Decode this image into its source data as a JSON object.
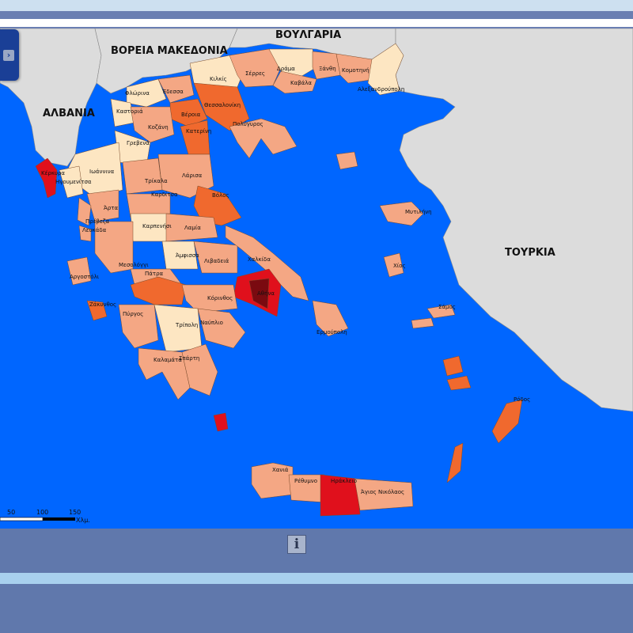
{
  "map": {
    "colors": {
      "sea": "#0066ff",
      "neighbor_land": "#dcdcdc",
      "tier1": "#fde6c2",
      "tier2": "#f4a784",
      "tier3": "#f0692e",
      "tier4": "#e0101c",
      "tier5": "#7a0a10"
    },
    "countries": [
      {
        "id": "albania",
        "label": "ΑΛΒΑΝΙΑ"
      },
      {
        "id": "north-macedonia",
        "label": "ΒΟΡΕΙΑ ΜΑΚΕΔΟΝΙΑ"
      },
      {
        "id": "bulgaria",
        "label": "ΒΟΥΛΓΑΡΙΑ"
      },
      {
        "id": "turkey",
        "label": "ΤΟΥΡΚΙΑ"
      }
    ],
    "cities": [
      "Κιλκίς",
      "Σέρρες",
      "Δράμα",
      "Ξάνθη",
      "Κομοτηνή",
      "Καβάλα",
      "Αλεξανδρούπολη",
      "Φλώρινα",
      "Έδεσσα",
      "Καστοριά",
      "Θεσσαλονίκη",
      "Βέροια",
      "Κοζάνη",
      "Κατερίνη",
      "Πολύγυρος",
      "Γρεβενά",
      "Ιωάννινα",
      "Κέρκυρα",
      "Ηγουμενίτσα",
      "Τρίκαλα",
      "Λάρισα",
      "Καρδίτσα",
      "Βόλος",
      "Άρτα",
      "Πρέβεζα",
      "Λευκάδα",
      "Καρπενήσι",
      "Λαμία",
      "Μυτιλήνη",
      "Άμφισσα",
      "Λιβαδειά",
      "Χαλκίδα",
      "Μεσολόγγι",
      "Αργοστόλι",
      "Πάτρα",
      "Χίος",
      "Κόρινθος",
      "Αθήνα",
      "Ζάκυνθος",
      "Πύργος",
      "Τρίπολη",
      "Ναύπλιο",
      "Σάμος",
      "Ερμούπολη",
      "Καλαμάτα",
      "Σπάρτη",
      "Ρόδος",
      "Χανιά",
      "Ρέθυμνο",
      "Ηράκλειο",
      "Άγιος Νικόλαος"
    ],
    "scale": {
      "ticks": [
        "50",
        "100",
        "150"
      ],
      "unit": "Χλμ."
    }
  },
  "ui": {
    "sidebar_toggle_glyph": "›",
    "info_glyph": "i"
  }
}
